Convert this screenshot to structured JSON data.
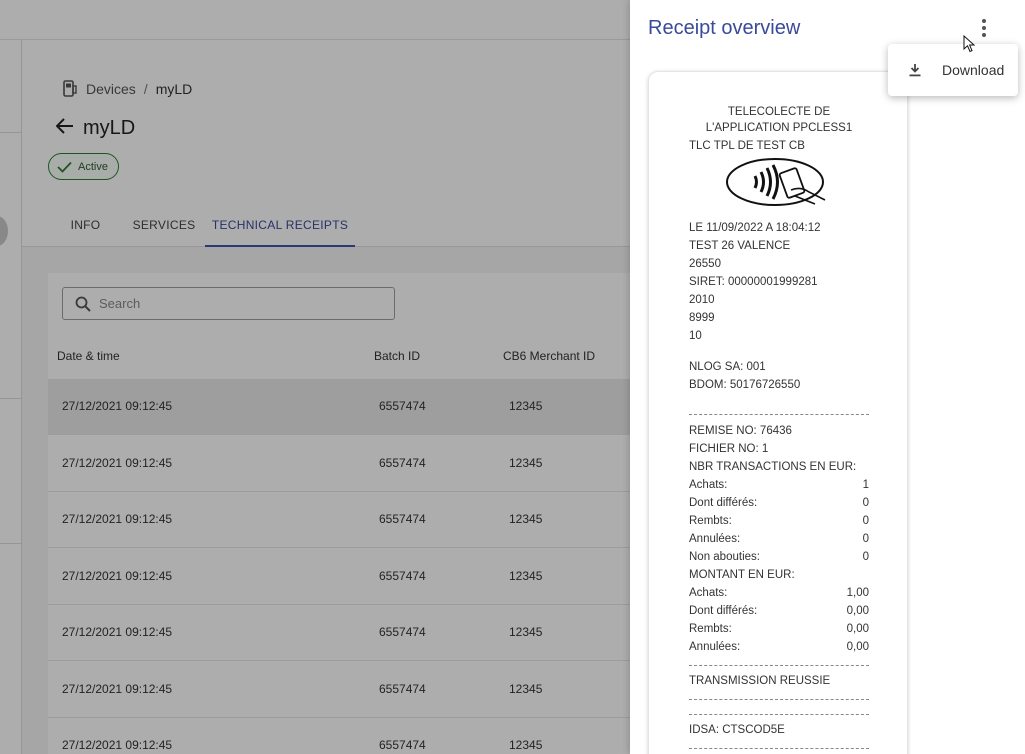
{
  "breadcrumb": {
    "root": "Devices",
    "separator": "/",
    "current": "myLD"
  },
  "page": {
    "title": "myLD",
    "status": "Active"
  },
  "tabs": [
    {
      "label": "INFO",
      "active": false
    },
    {
      "label": "SERVICES",
      "active": false
    },
    {
      "label": "TECHNICAL RECEIPTS",
      "active": true
    }
  ],
  "search": {
    "placeholder": "Search",
    "value": ""
  },
  "table": {
    "columns": [
      "Date & time",
      "Batch ID",
      "CB6 Merchant ID"
    ],
    "rows": [
      [
        "27/12/2021 09:12:45",
        "6557474",
        "12345"
      ],
      [
        "27/12/2021 09:12:45",
        "6557474",
        "12345"
      ],
      [
        "27/12/2021 09:12:45",
        "6557474",
        "12345"
      ],
      [
        "27/12/2021 09:12:45",
        "6557474",
        "12345"
      ],
      [
        "27/12/2021 09:12:45",
        "6557474",
        "12345"
      ],
      [
        "27/12/2021 09:12:45",
        "6557474",
        "12345"
      ],
      [
        "27/12/2021 09:12:45",
        "6557474",
        "12345"
      ]
    ]
  },
  "drawer": {
    "title": "Receipt overview",
    "menu": {
      "download_label": "Download"
    }
  },
  "receipt": {
    "header": [
      "TELECOLECTE DE",
      "L'APPLICATION PPCLESS1"
    ],
    "subheader": "TLC TPL DE TEST CB",
    "info": [
      "LE 11/09/2022 A 18:04:12",
      "TEST 26 VALENCE",
      "26550",
      "SIRET: 00000001999281",
      "2010",
      "8999",
      "10"
    ],
    "nlog": [
      "NLOG SA: 001",
      "BDOM: 50176726550"
    ],
    "remise": [
      "REMISE NO: 76436",
      "FICHIER NO: 1",
      "NBR TRANSACTIONS EN EUR:"
    ],
    "counts": [
      {
        "label": "Achats:",
        "value": "1"
      },
      {
        "label": "Dont différés:",
        "value": "0"
      },
      {
        "label": "Rembts:",
        "value": "0"
      },
      {
        "label": "Annulées:",
        "value": "0"
      },
      {
        "label": "Non abouties:",
        "value": "0"
      }
    ],
    "montant_label": "MONTANT EN EUR:",
    "amounts": [
      {
        "label": "Achats:",
        "value": "1,00"
      },
      {
        "label": "Dont différés:",
        "value": "0,00"
      },
      {
        "label": "Rembts:",
        "value": "0,00"
      },
      {
        "label": "Annulées:",
        "value": "0,00"
      }
    ],
    "transmission": "TRANSMISSION REUSSIE",
    "idsa": "IDSA: CTSCOD5E"
  },
  "colors": {
    "accent": "#3f51b5",
    "status_green": "#2e7d32",
    "title_blue": "#3a4a9a"
  },
  "icons": [
    "device-icon",
    "back-arrow-icon",
    "check-icon",
    "search-icon",
    "more-vert-icon",
    "download-icon",
    "contactless-card-icon",
    "mouse-cursor-icon"
  ]
}
